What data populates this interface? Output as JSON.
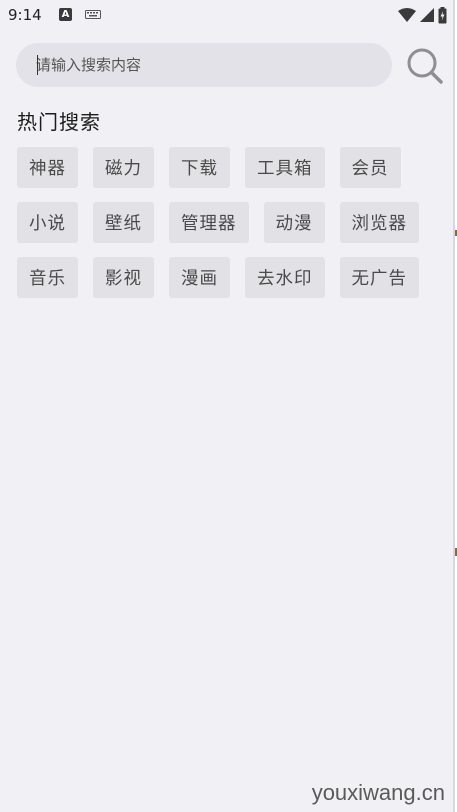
{
  "status_bar": {
    "time": "9:14",
    "notification_a_icon": "A"
  },
  "search": {
    "placeholder": "请输入搜索内容",
    "value": ""
  },
  "hot_search": {
    "title": "热门搜索",
    "rows": [
      [
        {
          "label": "神器"
        },
        {
          "label": "磁力"
        },
        {
          "label": "下载"
        },
        {
          "label": "工具箱"
        },
        {
          "label": "会员"
        }
      ],
      [
        {
          "label": "小说"
        },
        {
          "label": "壁纸"
        },
        {
          "label": "管理器"
        },
        {
          "label": "动漫"
        },
        {
          "label": "浏览器"
        }
      ],
      [
        {
          "label": "音乐"
        },
        {
          "label": "影视"
        },
        {
          "label": "漫画"
        },
        {
          "label": "去水印"
        },
        {
          "label": "无广告"
        }
      ]
    ]
  },
  "watermark": "youxiwang.cn",
  "icons": {
    "search": "search-icon",
    "wifi": "wifi-icon",
    "signal": "signal-icon",
    "battery": "battery-icon",
    "keyboard": "keyboard-icon"
  },
  "colors": {
    "background": "#f1f0f5",
    "search_box": "#e3e2e8",
    "tag_background": "#e2e1e6",
    "tag_text": "#4a4a4a",
    "search_icon": "#8e8e93"
  }
}
